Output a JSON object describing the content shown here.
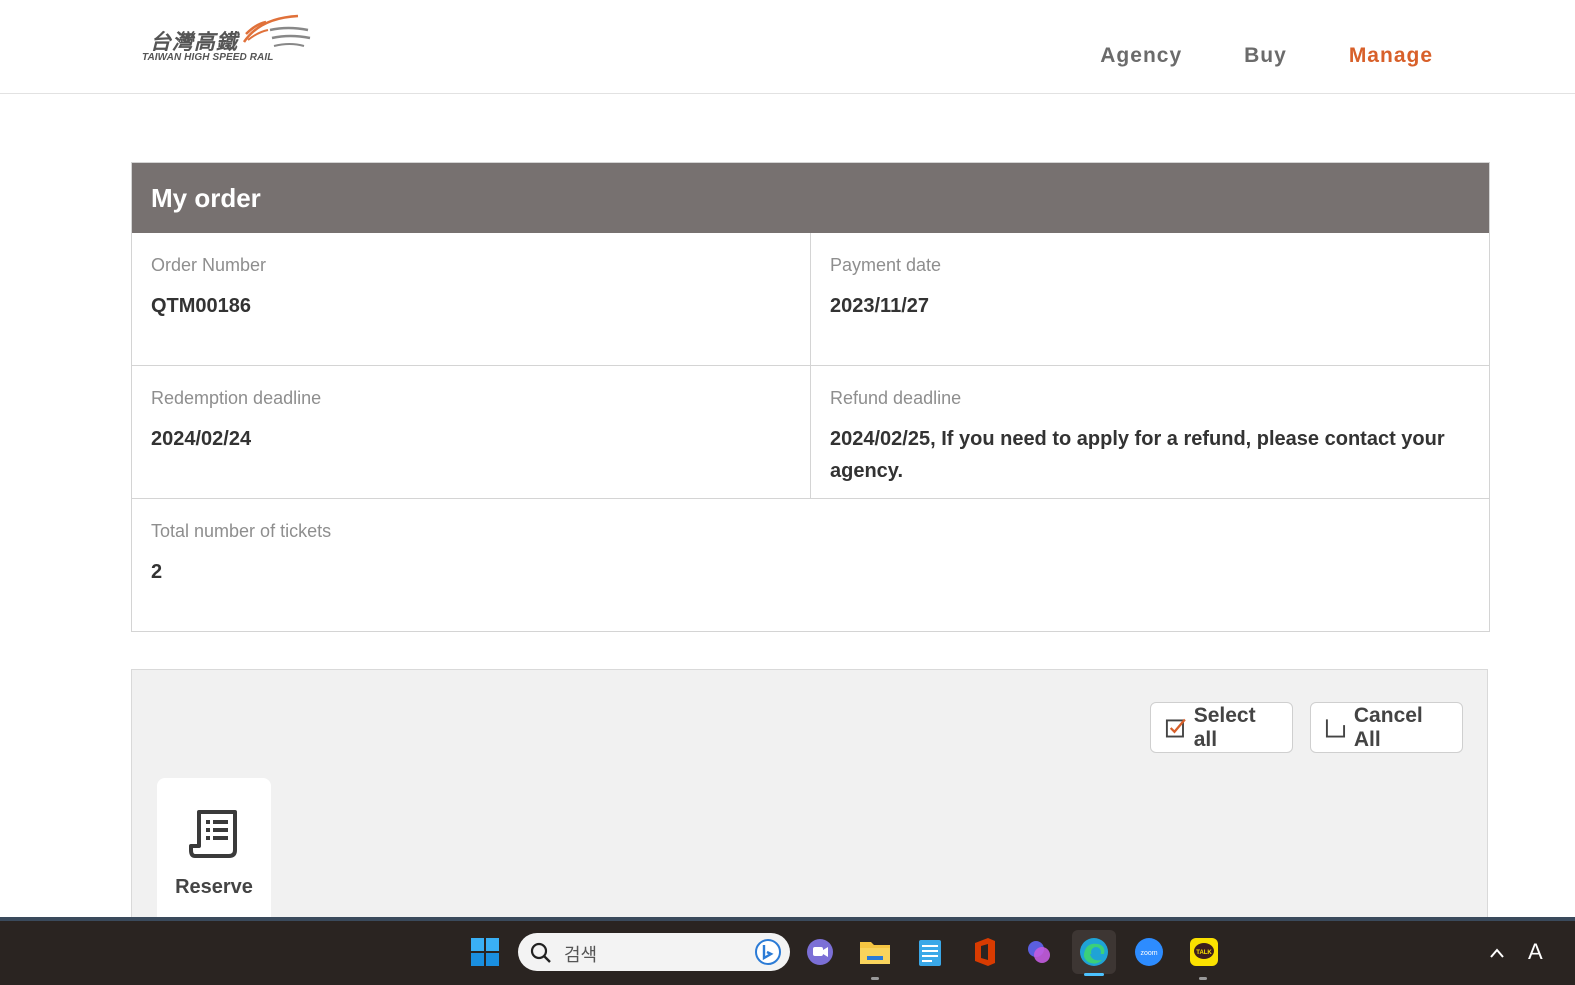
{
  "header": {
    "logo_zh": "台灣高鐵",
    "logo_en": "TAIWAN HIGH SPEED RAIL",
    "nav": [
      {
        "label": "Agency",
        "active": false
      },
      {
        "label": "Buy",
        "active": false
      },
      {
        "label": "Manage",
        "active": true
      }
    ]
  },
  "order": {
    "title": "My order",
    "order_number_label": "Order Number",
    "order_number": "QTM00186",
    "payment_date_label": "Payment date",
    "payment_date": "2023/11/27",
    "redemption_label": "Redemption deadline",
    "redemption_deadline": "2024/02/24",
    "refund_label": "Refund deadline",
    "refund_deadline": "2024/02/25, If you need to apply for a refund, please contact your agency.",
    "total_label": "Total number of tickets",
    "total_tickets": "2"
  },
  "tickets": {
    "select_all": "Select all",
    "cancel_all": "Cancel All",
    "reserve": "Reserve"
  },
  "taskbar": {
    "search_placeholder": "검색",
    "tray_ime": "A"
  },
  "colors": {
    "accent": "#d8602a",
    "panel_header": "#777170",
    "taskbar": "#2a2421"
  }
}
